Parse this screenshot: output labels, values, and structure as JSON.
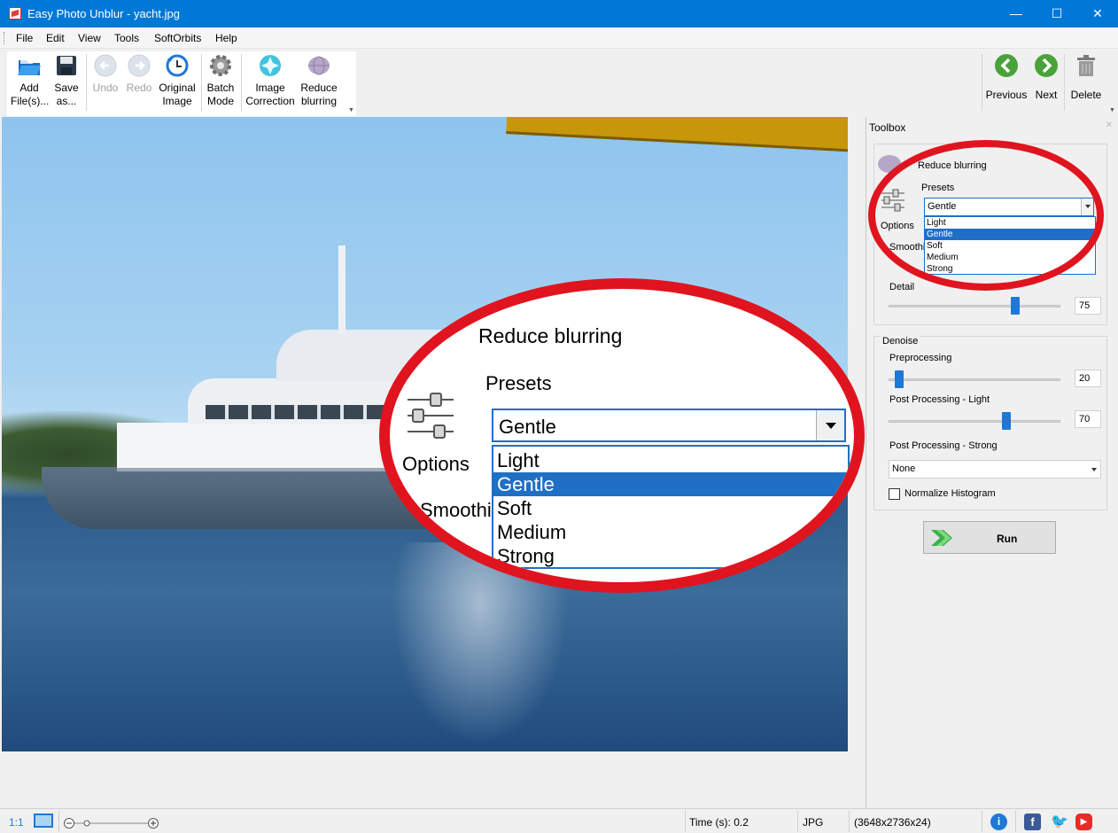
{
  "window": {
    "title": "Easy Photo Unblur - yacht.jpg",
    "controls": {
      "minimize": "—",
      "maximize": "☐",
      "close": "✕"
    }
  },
  "menu": [
    "File",
    "Edit",
    "View",
    "Tools",
    "SoftOrbits",
    "Help"
  ],
  "toolbar": {
    "add_files": "Add\nFile(s)...",
    "save_as": "Save\nas...",
    "undo": "Undo",
    "redo": "Redo",
    "original_image": "Original\nImage",
    "batch_mode": "Batch\nMode",
    "image_correction": "Image\nCorrection",
    "reduce_blurring": "Reduce\nblurring",
    "previous": "Previous",
    "next": "Next",
    "delete": "Delete"
  },
  "zoom_callout": {
    "title": "Reduce blurring",
    "presets_label": "Presets",
    "options_label": "Options",
    "smoothing_label": "Smoothi",
    "preset_selected": "Gentle",
    "preset_options": [
      "Light",
      "Gentle",
      "Soft",
      "Medium",
      "Strong"
    ]
  },
  "toolbox": {
    "title": "Toolbox",
    "section_title": "Reduce blurring",
    "presets_label": "Presets",
    "preset_selected": "Gentle",
    "preset_options": [
      "Light",
      "Gentle",
      "Soft",
      "Medium",
      "Strong"
    ],
    "options_label": "Options",
    "smoothing_label": "Smoothi",
    "detail_label": "Detail",
    "detail_value": "75",
    "denoise": {
      "title": "Denoise",
      "preprocessing_label": "Preprocessing",
      "preprocessing_value": "20",
      "post_light_label": "Post Processing - Light",
      "post_light_value": "70",
      "post_strong_label": "Post Processing - Strong",
      "post_strong_value": "None",
      "normalize_label": "Normalize Histogram",
      "normalize_checked": false
    },
    "run_label": "Run"
  },
  "status": {
    "zoom_label": "1:1",
    "time": "Time (s): 0.2",
    "format": "JPG",
    "dimensions": "(3648x2736x24)"
  },
  "colors": {
    "accent": "#0078d7",
    "highlight_ring": "#e0141e",
    "selection": "#1f6fc5"
  }
}
